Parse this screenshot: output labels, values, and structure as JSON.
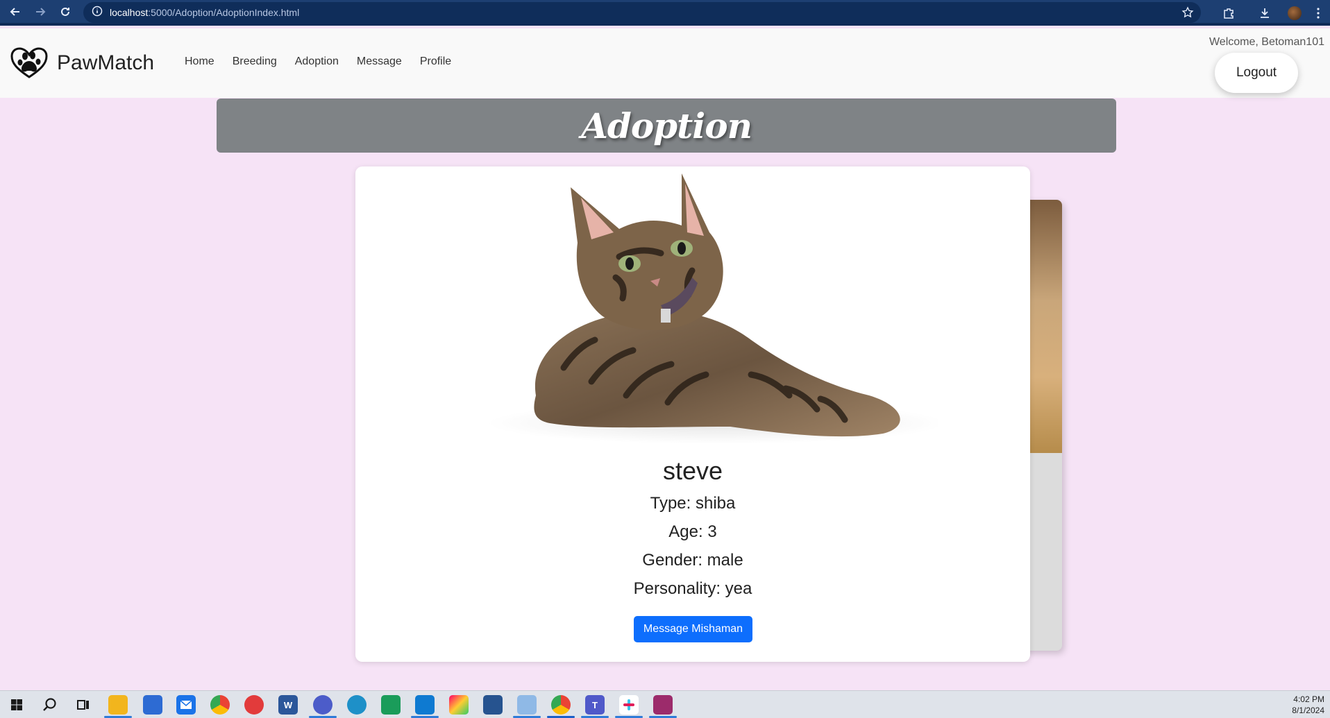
{
  "browser": {
    "url_host": "localhost",
    "url_path": ":5000/Adoption/AdoptionIndex.html"
  },
  "header": {
    "brand": "PawMatch",
    "nav": [
      "Home",
      "Breeding",
      "Adoption",
      "Message",
      "Profile"
    ],
    "welcome": "Welcome, Betoman101",
    "logout_label": "Logout"
  },
  "banner": {
    "title": "Adoption"
  },
  "pet": {
    "name": "steve",
    "type_line": "Type: shiba",
    "age_line": "Age: 3",
    "gender_line": "Gender: male",
    "personality_line": "Personality: yea",
    "message_button": "Message Mishaman"
  },
  "taskbar": {
    "time": "4:02 PM",
    "date": "8/1/2024",
    "apps": [
      "start",
      "search",
      "task-view",
      "file-explorer",
      "store",
      "mail",
      "chrome",
      "app-red",
      "word",
      "app-badge",
      "edge",
      "app-green",
      "vscode",
      "app-color",
      "virtualbox",
      "app-blue",
      "chrome-profile",
      "teams",
      "slack",
      "winrar"
    ]
  },
  "colors": {
    "page_bg": "#f6e3f6",
    "banner_bg": "#7f8386",
    "primary_button": "#0d6efd",
    "browser_bar": "#1d3f72"
  }
}
